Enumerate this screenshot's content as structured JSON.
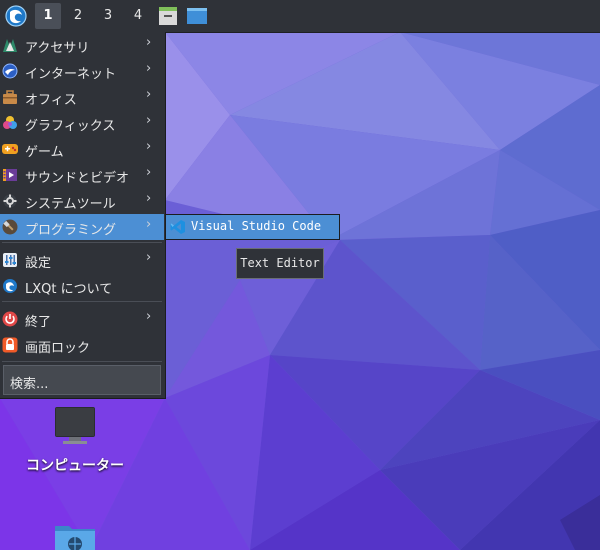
{
  "taskbar": {
    "desktops": [
      "1",
      "2",
      "3",
      "4"
    ],
    "active_desktop": "1",
    "apps": [
      "archive-manager-icon",
      "window-icon"
    ]
  },
  "menu": {
    "items": [
      {
        "label": "アクセサリ",
        "icon": "accessories-icon",
        "submenu": true
      },
      {
        "label": "インターネット",
        "icon": "internet-icon",
        "submenu": true
      },
      {
        "label": "オフィス",
        "icon": "office-icon",
        "submenu": true
      },
      {
        "label": "グラフィックス",
        "icon": "graphics-icon",
        "submenu": true
      },
      {
        "label": "ゲーム",
        "icon": "games-icon",
        "submenu": true
      },
      {
        "label": "サウンドとビデオ",
        "icon": "multimedia-icon",
        "submenu": true
      },
      {
        "label": "システムツール",
        "icon": "system-tools-icon",
        "submenu": true
      },
      {
        "label": "プログラミング",
        "icon": "programming-icon",
        "submenu": true,
        "selected": true
      },
      {
        "label": "設定",
        "icon": "settings-icon",
        "submenu": true
      },
      {
        "label": "LXQt について",
        "icon": "lxqt-icon",
        "submenu": false
      },
      {
        "label": "終了",
        "icon": "power-icon",
        "submenu": true
      },
      {
        "label": "画面ロック",
        "icon": "lock-icon",
        "submenu": false
      }
    ],
    "search_placeholder": "検索..."
  },
  "submenu": {
    "items": [
      {
        "label": "Visual Studio Code",
        "icon": "vscode-icon"
      }
    ]
  },
  "tooltip": {
    "text": "Text Editor"
  },
  "desktop_icons": [
    {
      "label": "コンピューター",
      "icon": "computer-icon"
    },
    {
      "label": "",
      "icon": "network-folder-icon"
    }
  ],
  "colors": {
    "panel": "#2f3238",
    "highlight": "#4c8fd4",
    "text": "#e8e8e8",
    "wallpaper": "#6b5fd6"
  }
}
